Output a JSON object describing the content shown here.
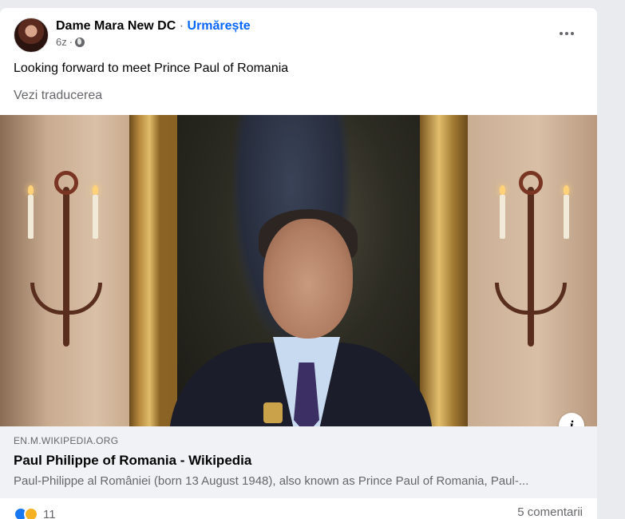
{
  "post": {
    "author": "Dame Mara New DC",
    "separator": "·",
    "follow_label": "Urmărește",
    "time": "6z",
    "time_dot": "·",
    "privacy_icon": "globe-icon",
    "text": "Looking forward to meet Prince Paul of Romania",
    "translate_label": "Vezi traducerea"
  },
  "link": {
    "domain": "EN.M.WIKIPEDIA.ORG",
    "title": "Paul Philippe of Romania - Wikipedia",
    "description": "Paul-Philippe al României (born 13 August 1948), also known as Prince Paul of Romania, Paul-..."
  },
  "info_button_label": "i",
  "footer": {
    "reaction_count": "11",
    "comments_label": "5 comentarii"
  },
  "colors": {
    "accent": "#0866ff",
    "secondary_text": "#65676b",
    "preview_bg": "#f0f2f5"
  }
}
